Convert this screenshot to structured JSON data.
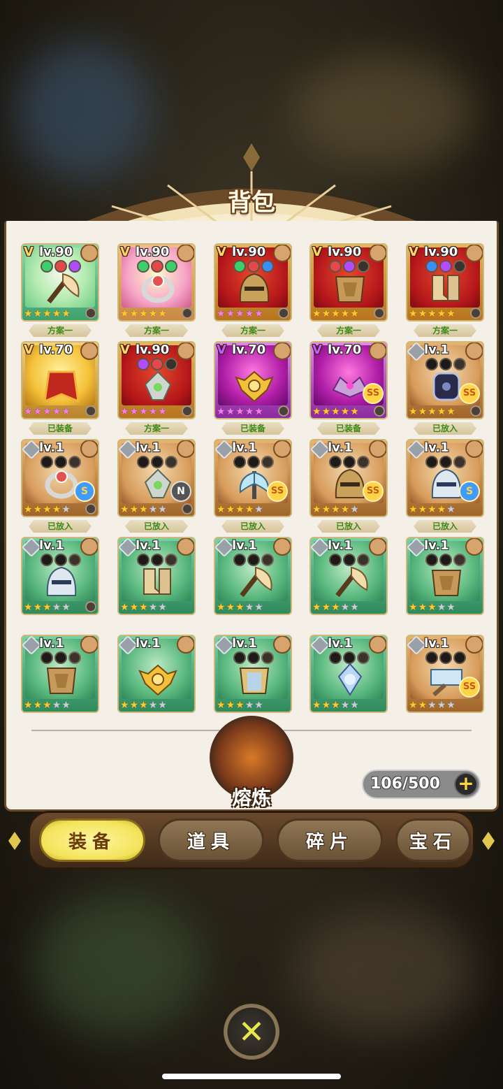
{
  "title": "背包",
  "cards": [
    {
      "lv": "lv.90",
      "badge": "V",
      "badge_color": "gold",
      "frame": "green",
      "stars": "55555",
      "star_type": "on",
      "sockets": [
        "g",
        "r",
        "p"
      ],
      "lock": true,
      "shape": "axe",
      "tag": "方案一"
    },
    {
      "lv": "lv.90",
      "badge": "V",
      "badge_color": "gold",
      "frame": "pink",
      "stars": "55555",
      "star_type": "on",
      "sockets": [
        "g",
        "r",
        "g"
      ],
      "lock": true,
      "shape": "ring",
      "tag": "方案一"
    },
    {
      "lv": "lv.90",
      "badge": "V",
      "badge_color": "gold",
      "frame": "red",
      "stars": "55555",
      "star_type": "pink",
      "sockets": [
        "g",
        "r",
        "b"
      ],
      "lock": true,
      "shape": "helm",
      "tag": "方案一"
    },
    {
      "lv": "lv.90",
      "badge": "V",
      "badge_color": "gold",
      "frame": "red",
      "stars": "55555",
      "star_type": "on",
      "sockets": [
        "r",
        "p",
        "x"
      ],
      "lock": true,
      "shape": "armor",
      "tag": "方案一"
    },
    {
      "lv": "lv.90",
      "badge": "V",
      "badge_color": "gold",
      "frame": "red",
      "stars": "55555",
      "star_type": "on",
      "sockets": [
        "b",
        "p",
        "x"
      ],
      "lock": true,
      "shape": "boots",
      "tag": "方案一"
    },
    {
      "lv": "lv.70",
      "badge": "V",
      "badge_color": "gold",
      "frame": "gold",
      "stars": "55555",
      "star_type": "pink",
      "sockets": [],
      "lock": true,
      "shape": "cape",
      "tag": "已装备"
    },
    {
      "lv": "lv.90",
      "badge": "V",
      "badge_color": "gold",
      "frame": "red",
      "stars": "55555",
      "star_type": "pink",
      "sockets": [
        "p",
        "r",
        "x"
      ],
      "lock": true,
      "shape": "amulet",
      "tag": "方案一"
    },
    {
      "lv": "lv.70",
      "badge": "V",
      "badge_color": "purple",
      "frame": "purple",
      "stars": "55555",
      "star_type": "pink",
      "sockets": [],
      "lock": true,
      "shape": "emblem",
      "tag": "已装备"
    },
    {
      "lv": "lv.70",
      "badge": "V",
      "badge_color": "purple",
      "frame": "purple",
      "stars": "55555",
      "star_type": "on",
      "sockets": [],
      "lock": true,
      "shape": "crown",
      "grade": "SS",
      "tag": "已装备"
    },
    {
      "lv": "lv.1",
      "badge": "",
      "badge_color": "",
      "frame": "orange",
      "stars": "55555",
      "star_type": "on",
      "sockets": [
        "k",
        "k",
        "x"
      ],
      "lock": true,
      "shape": "bracer",
      "grade": "SS",
      "tag": "已放入"
    },
    {
      "lv": "lv.1",
      "badge": "",
      "badge_color": "",
      "frame": "orange",
      "stars": "44440",
      "star_type": "on",
      "sockets": [
        "k",
        "k",
        "x"
      ],
      "lock": true,
      "shape": "ring",
      "grade": "S",
      "tag": "已放入"
    },
    {
      "lv": "lv.1",
      "badge": "",
      "badge_color": "",
      "frame": "orange",
      "stars": "33300",
      "star_type": "on",
      "sockets": [
        "k",
        "k",
        "x"
      ],
      "lock": true,
      "shape": "amulet",
      "grade": "N",
      "tag": "已放入"
    },
    {
      "lv": "lv.1",
      "badge": "",
      "badge_color": "",
      "frame": "orange",
      "stars": "44440",
      "star_type": "on",
      "sockets": [
        "k",
        "k",
        "x"
      ],
      "lock": false,
      "shape": "axe2",
      "grade": "SS",
      "tag": "已放入"
    },
    {
      "lv": "lv.1",
      "badge": "",
      "badge_color": "",
      "frame": "orange",
      "stars": "44440",
      "star_type": "on",
      "sockets": [
        "k",
        "k",
        "x"
      ],
      "lock": false,
      "shape": "helm",
      "grade": "SS",
      "tag": "已放入"
    },
    {
      "lv": "lv.1",
      "badge": "",
      "badge_color": "",
      "frame": "orange",
      "stars": "44440",
      "star_type": "on",
      "sockets": [
        "k",
        "k",
        "x"
      ],
      "lock": false,
      "shape": "helm2",
      "grade": "S",
      "tag": "已放入"
    },
    {
      "lv": "lv.1",
      "badge": "",
      "badge_color": "",
      "frame": "teal",
      "stars": "33300",
      "star_type": "on",
      "sockets": [
        "k",
        "k",
        "x"
      ],
      "lock": true,
      "shape": "helm2",
      "tag": ""
    },
    {
      "lv": "lv.1",
      "badge": "",
      "badge_color": "",
      "frame": "teal",
      "stars": "33300",
      "star_type": "on",
      "sockets": [
        "k",
        "k",
        "x"
      ],
      "lock": false,
      "shape": "boots",
      "tag": ""
    },
    {
      "lv": "lv.1",
      "badge": "",
      "badge_color": "",
      "frame": "teal",
      "stars": "33300",
      "star_type": "on",
      "sockets": [
        "k",
        "k",
        "x"
      ],
      "lock": false,
      "shape": "axe",
      "tag": ""
    },
    {
      "lv": "lv.1",
      "badge": "",
      "badge_color": "",
      "frame": "teal",
      "stars": "33300",
      "star_type": "on",
      "sockets": [
        "k",
        "k",
        "x"
      ],
      "lock": false,
      "shape": "axe",
      "tag": ""
    },
    {
      "lv": "lv.1",
      "badge": "",
      "badge_color": "",
      "frame": "teal",
      "stars": "33300",
      "star_type": "on",
      "sockets": [
        "k",
        "k",
        "x"
      ],
      "lock": false,
      "shape": "armor",
      "tag": ""
    },
    {
      "lv": "lv.1",
      "badge": "",
      "badge_color": "",
      "frame": "teal",
      "stars": "33300",
      "star_type": "on",
      "sockets": [
        "k",
        "k",
        "x"
      ],
      "lock": false,
      "shape": "armor",
      "tag": ""
    },
    {
      "lv": "lv.1",
      "badge": "",
      "badge_color": "",
      "frame": "teal",
      "stars": "33300",
      "star_type": "on",
      "sockets": [],
      "lock": false,
      "shape": "emblem",
      "tag": ""
    },
    {
      "lv": "lv.1",
      "badge": "",
      "badge_color": "",
      "frame": "teal",
      "stars": "33300",
      "star_type": "on",
      "sockets": [
        "k",
        "k",
        "x"
      ],
      "lock": false,
      "shape": "armor2",
      "tag": ""
    },
    {
      "lv": "lv.1",
      "badge": "",
      "badge_color": "",
      "frame": "teal",
      "stars": "33300",
      "star_type": "on",
      "sockets": [
        "k",
        "k",
        "x"
      ],
      "lock": false,
      "shape": "crystal",
      "tag": ""
    },
    {
      "lv": "lv.1",
      "badge": "",
      "badge_color": "",
      "frame": "orange",
      "stars": "22000",
      "star_type": "on",
      "sockets": [
        "k",
        "k",
        "k"
      ],
      "lock": false,
      "shape": "hammer",
      "grade": "SS",
      "tag": ""
    }
  ],
  "smelt_label": "熔炼",
  "capacity": "106/500",
  "capacity_plus": "+",
  "tabs": [
    {
      "label": "装备",
      "active": true
    },
    {
      "label": "道具",
      "active": false
    },
    {
      "label": "碎片",
      "active": false
    },
    {
      "label": "宝石",
      "active": false
    }
  ],
  "close_label": "✕"
}
